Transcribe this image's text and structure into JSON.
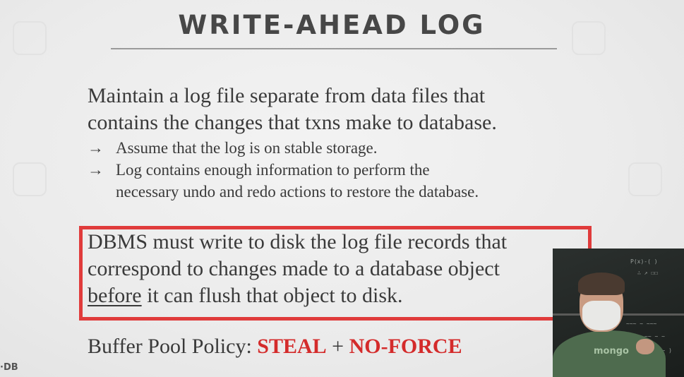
{
  "slide": {
    "title": "WRITE-AHEAD LOG",
    "intro_line1": "Maintain a log file separate from data files that",
    "intro_line2": "contains the changes that txns make to database.",
    "bullets": [
      {
        "arrow": "→",
        "line1": "Assume that the log is on stable storage.",
        "line2": ""
      },
      {
        "arrow": "→",
        "line1": "Log contains enough information to perform the",
        "line2": "necessary undo and redo actions to restore the database."
      }
    ],
    "callout": {
      "line1": "DBMS must write to disk the log file records that",
      "line2": "correspond to changes made to a database object",
      "line3_underlined": "before",
      "line3_rest": " it can flush that object to disk."
    },
    "policy": {
      "label": "Buffer Pool Policy: ",
      "steal": "STEAL",
      "plus": " + ",
      "noforce": "NO-FORCE"
    },
    "logo_text": "·DB",
    "colors": {
      "highlight_red": "#d42b2b",
      "callout_border": "#e03b3b"
    }
  },
  "webcam": {
    "shirt_text": "mongo"
  }
}
